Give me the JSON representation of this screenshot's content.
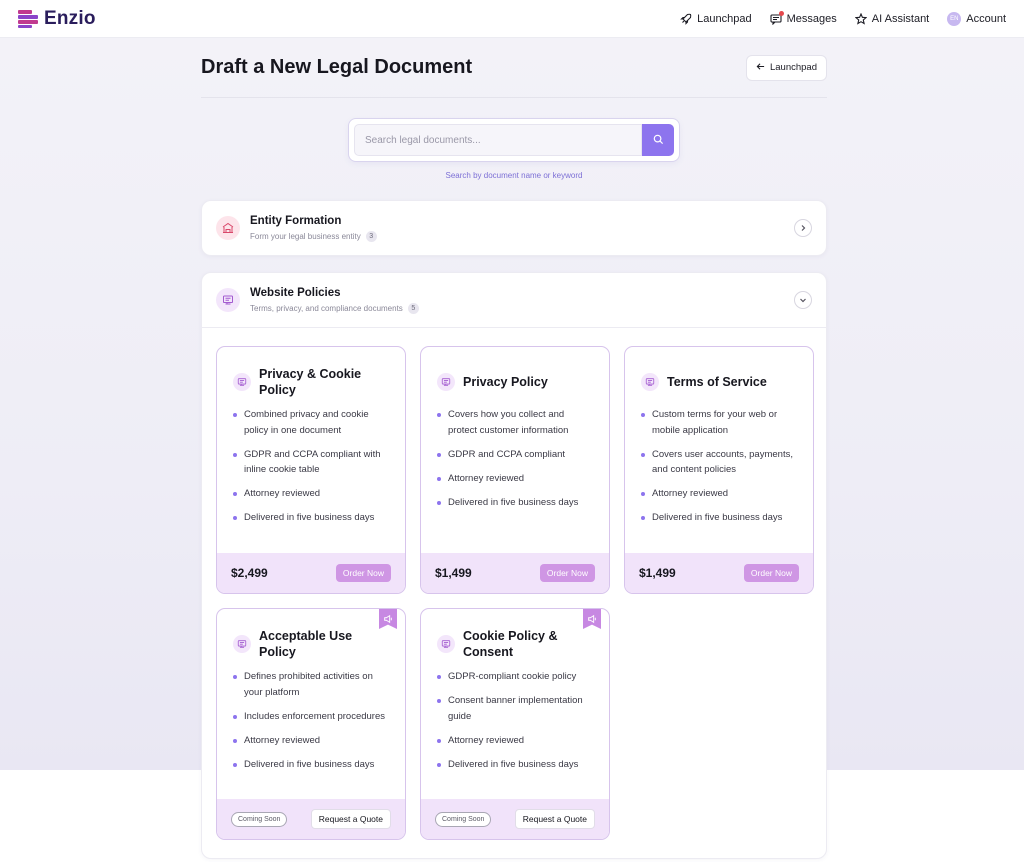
{
  "app": {
    "name": "Enzio"
  },
  "nav": {
    "launchpad": "Launchpad",
    "messages": "Messages",
    "ai_assistant": "AI Assistant",
    "account": "Account",
    "avatar_initials": "EN"
  },
  "page": {
    "title": "Draft a New Legal Document",
    "back_label": "Launchpad"
  },
  "search": {
    "placeholder": "Search legal documents...",
    "hint": "Search by document name or keyword"
  },
  "categories": [
    {
      "title": "Entity Formation",
      "subtitle": "Form your legal business entity",
      "count": "3",
      "icon": "building-icon",
      "expanded": false
    },
    {
      "title": "Website Policies",
      "subtitle": "Terms, privacy, and compliance documents",
      "count": "5",
      "icon": "monitor-icon",
      "expanded": true
    }
  ],
  "documents": [
    {
      "title": "Privacy & Cookie Policy",
      "features": [
        "Combined privacy and cookie policy in one document",
        "GDPR and CCPA compliant with inline cookie table",
        "Attorney reviewed",
        "Delivered in five business days"
      ],
      "price": "$2,499",
      "action": "Order Now"
    },
    {
      "title": "Privacy Policy",
      "features": [
        "Covers how you collect and protect customer information",
        "GDPR and CCPA compliant",
        "Attorney reviewed",
        "Delivered in five business days"
      ],
      "price": "$1,499",
      "action": "Order Now"
    },
    {
      "title": "Terms of Service",
      "features": [
        "Custom terms for your web or mobile application",
        "Covers user accounts, payments, and content policies",
        "Attorney reviewed",
        "Delivered in five business days"
      ],
      "price": "$1,499",
      "action": "Order Now"
    },
    {
      "title": "Acceptable Use Policy",
      "features": [
        "Defines prohibited activities on your platform",
        "Includes enforcement procedures",
        "Attorney reviewed",
        "Delivered in five business days"
      ],
      "status": "Coming Soon",
      "action": "Request a Quote",
      "ribbon": "megaphone-icon"
    },
    {
      "title": "Cookie Policy & Consent",
      "features": [
        "GDPR-compliant cookie policy",
        "Consent banner implementation guide",
        "Attorney reviewed",
        "Delivered in five business days"
      ],
      "status": "Coming Soon",
      "action": "Request a Quote",
      "ribbon": "megaphone-icon"
    }
  ],
  "colors": {
    "accent": "#8d74ee",
    "card_footer": "#f1e3fa",
    "order_button": "#cf96e4",
    "brand_dark": "#2a1d5c"
  }
}
